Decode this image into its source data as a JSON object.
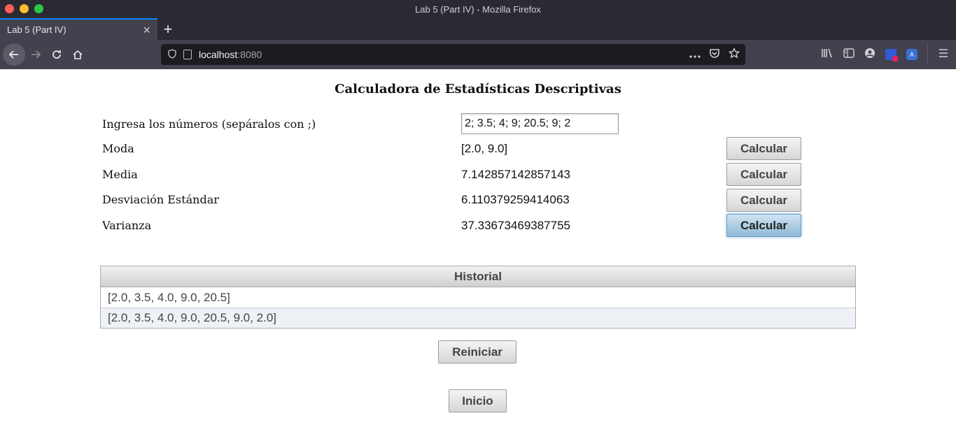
{
  "browser": {
    "window_title": "Lab 5 (Part IV) - Mozilla Firefox",
    "tab_title": "Lab 5 (Part IV)",
    "tab_close": "×",
    "new_tab": "+",
    "url_host": "localhost",
    "url_port": ":8080",
    "icons": [
      "back-icon",
      "forward-icon",
      "reload-icon",
      "home-icon",
      "shield-icon",
      "page-icon",
      "more-icon",
      "pocket-icon",
      "star-icon",
      "library-icon",
      "sidebar-icon",
      "account-icon",
      "extension-icon",
      "translate-icon",
      "menu-icon"
    ]
  },
  "page": {
    "title": "Calculadora de Estadísticas Descriptivas",
    "input": {
      "label": "Ingresa los números (sepáralos con ;)",
      "value": "2; 3.5; 4; 9; 20.5; 9; 2"
    },
    "rows": [
      {
        "label": "Moda",
        "value": "[2.0, 9.0]",
        "button": "Calcular"
      },
      {
        "label": "Media",
        "value": "7.142857142857143",
        "button": "Calcular"
      },
      {
        "label": "Desviación Estándar",
        "value": "6.110379259414063",
        "button": "Calcular"
      },
      {
        "label": "Varianza",
        "value": "37.33673469387755",
        "button": "Calcular"
      }
    ],
    "history": {
      "header": "Historial",
      "items": [
        "[2.0, 3.5, 4.0, 9.0, 20.5]",
        "[2.0, 3.5, 4.0, 9.0, 20.5, 9.0, 2.0]"
      ]
    },
    "reset_button": "Reiniciar",
    "home_button": "Inicio"
  }
}
